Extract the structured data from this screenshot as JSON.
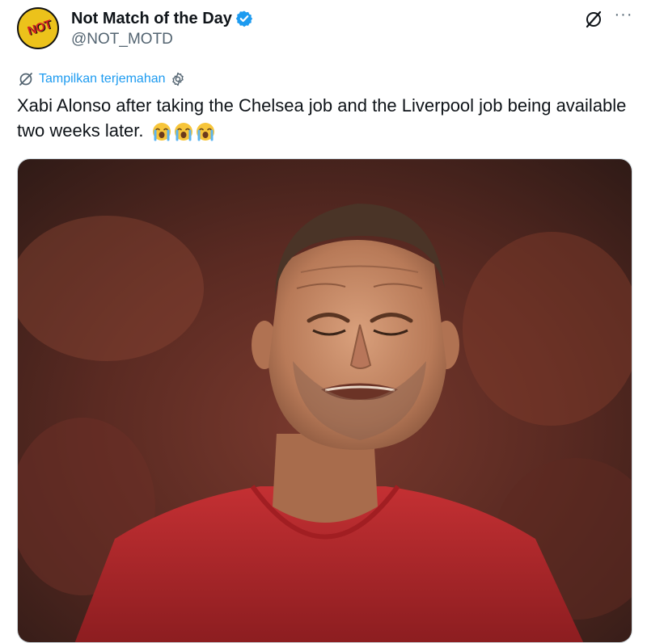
{
  "author": {
    "display_name": "Not Match of the Day",
    "handle": "@NOT_MOTD",
    "avatar_text": "NOT",
    "verified": true
  },
  "actions": {
    "grok_icon": "grok-icon",
    "more_icon": "more-icon",
    "more_label": "···"
  },
  "translate": {
    "label": "Tampilkan terjemahan",
    "icon": "translate-icon",
    "settings_icon": "settings-gear-icon"
  },
  "tweet": {
    "text": "Xabi Alonso after taking the Chelsea job and the Liverpool job being available two weeks later.",
    "emojis": [
      "loudly-crying-face",
      "loudly-crying-face",
      "loudly-crying-face"
    ]
  },
  "media": {
    "description_icon": "photo",
    "shirt_color": "#b3282b"
  },
  "colors": {
    "link": "#1d9bf0",
    "secondary_text": "#536471",
    "verified": "#1d9bf0"
  }
}
